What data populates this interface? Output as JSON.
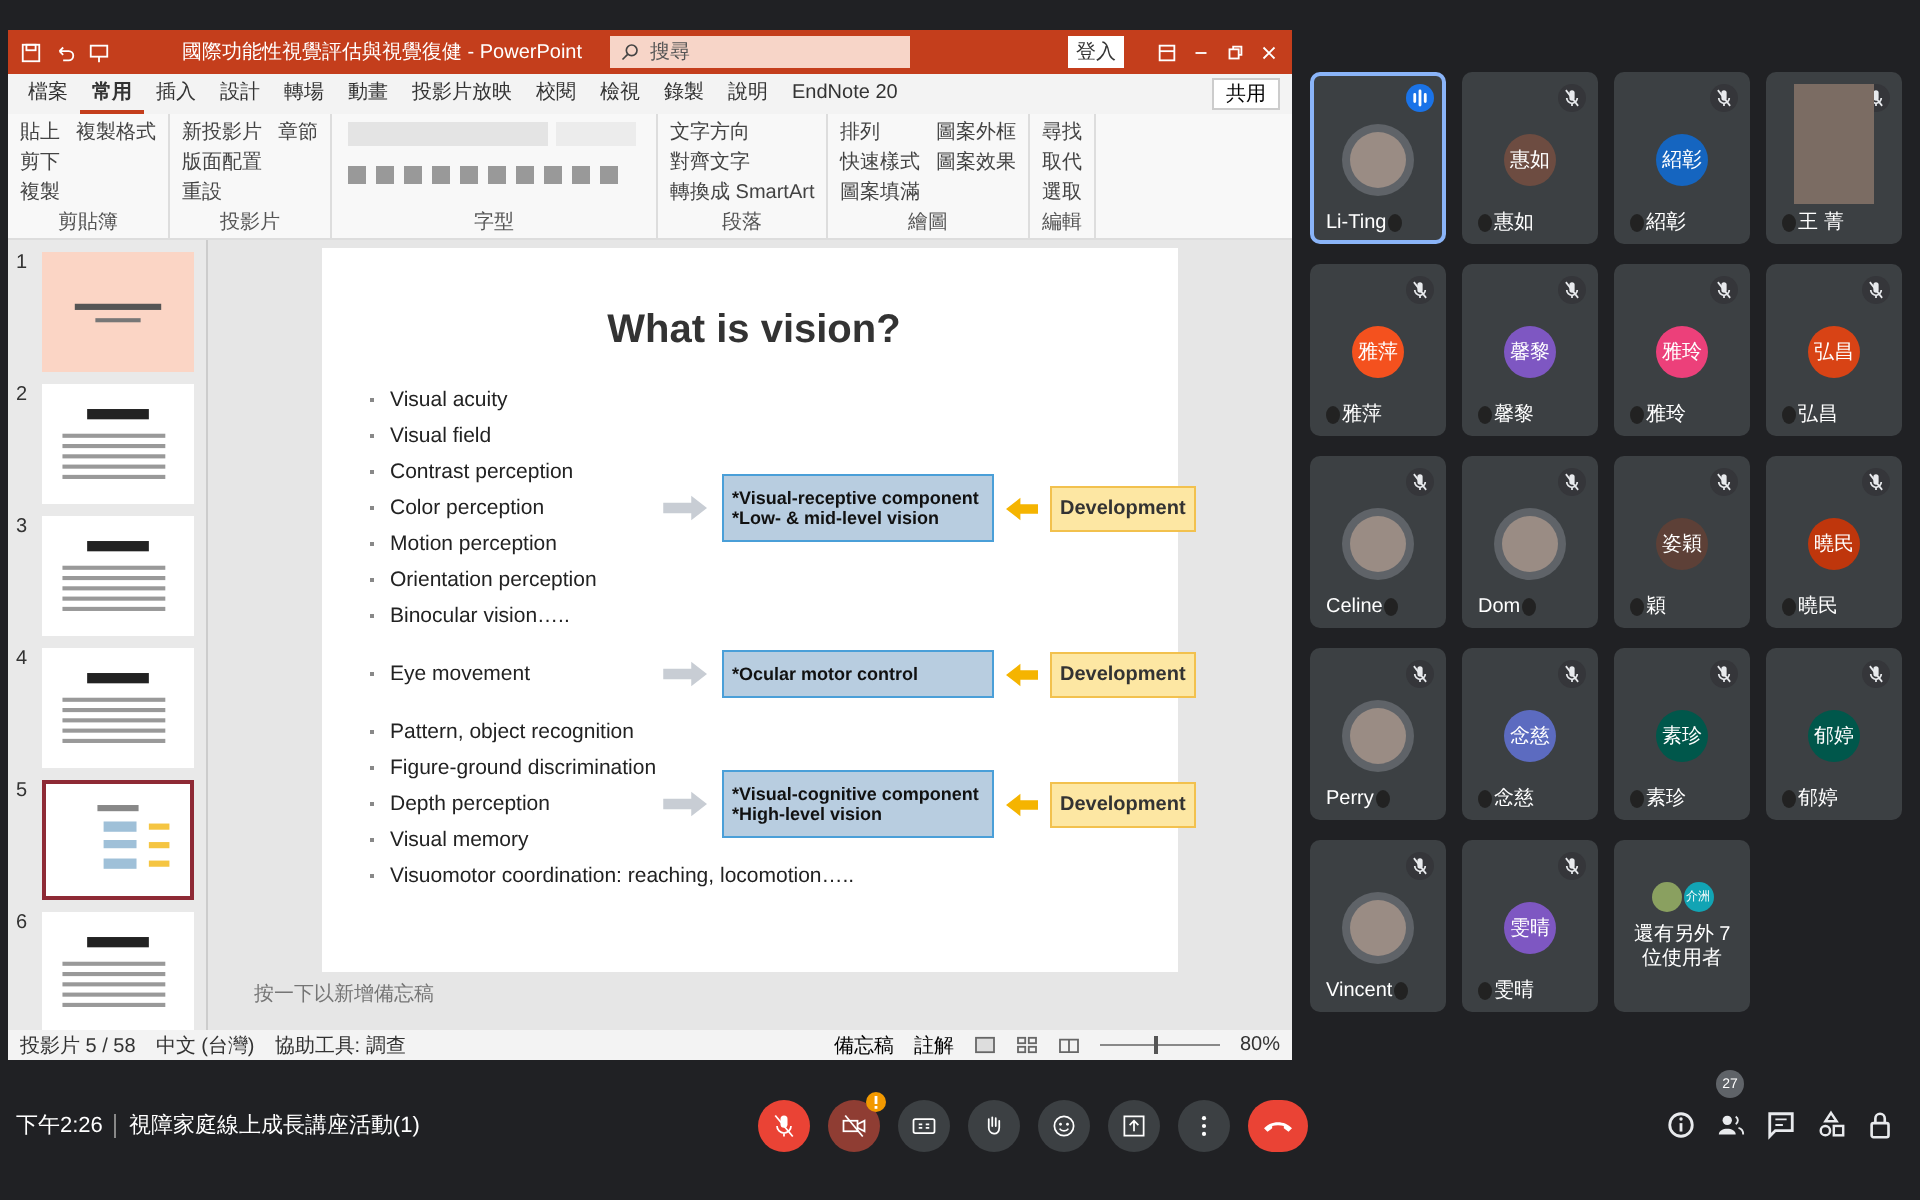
{
  "ppt": {
    "title": "國際功能性視覺評估與視覺復健 - PowerPoint",
    "search": {
      "placeholder": "搜尋"
    },
    "signin": "登入",
    "share": "共用",
    "tabs": [
      {
        "label": "檔案",
        "selected": false
      },
      {
        "label": "常用",
        "selected": true
      },
      {
        "label": "插入",
        "selected": false
      },
      {
        "label": "設計",
        "selected": false
      },
      {
        "label": "轉場",
        "selected": false
      },
      {
        "label": "動畫",
        "selected": false
      },
      {
        "label": "投影片放映",
        "selected": false
      },
      {
        "label": "校閱",
        "selected": false
      },
      {
        "label": "檢視",
        "selected": false
      },
      {
        "label": "錄製",
        "selected": false
      },
      {
        "label": "說明",
        "selected": false
      },
      {
        "label": "EndNote 20",
        "selected": false
      }
    ],
    "ribbon_groups": [
      {
        "name": "剪貼簿",
        "items": [
          "貼上",
          "剪下",
          "複製",
          "複製格式"
        ]
      },
      {
        "name": "投影片",
        "items": [
          "新投影片",
          "版面配置",
          "重設",
          "章節"
        ]
      },
      {
        "name": "字型"
      },
      {
        "name": "段落",
        "items": [
          "文字方向",
          "對齊文字",
          "轉換成 SmartArt"
        ]
      },
      {
        "name": "繪圖",
        "items": [
          "排列",
          "快速樣式",
          "圖案填滿",
          "圖案外框",
          "圖案效果"
        ]
      },
      {
        "name": "編輯",
        "items": [
          "尋找",
          "取代",
          "選取"
        ]
      }
    ]
  },
  "thumbnails": [
    {
      "number": "1",
      "kind": "title",
      "selected": false
    },
    {
      "number": "2",
      "kind": "text",
      "selected": false
    },
    {
      "number": "3",
      "kind": "text",
      "selected": false
    },
    {
      "number": "4",
      "kind": "text",
      "selected": false
    },
    {
      "number": "5",
      "kind": "diagram",
      "selected": true
    },
    {
      "number": "6",
      "kind": "text",
      "selected": false
    }
  ],
  "slide": {
    "title": "What is vision?",
    "groups": [
      {
        "bullets": [
          "Visual acuity",
          "Visual field",
          "Contrast perception",
          "Color perception",
          "Motion perception",
          "Orientation perception",
          "Binocular vision….."
        ],
        "box": [
          "*Visual-receptive component",
          "*Low- & mid-level vision"
        ],
        "tag": "Development"
      },
      {
        "bullets": [
          "Eye movement"
        ],
        "box": [
          "*Ocular motor control"
        ],
        "tag": "Development"
      },
      {
        "bullets": [
          "Pattern, object recognition",
          "Figure-ground discrimination",
          "Depth perception",
          "Visual memory",
          "Visuomotor coordination: reaching, locomotion….."
        ],
        "box": [
          "*Visual-cognitive component",
          "*High-level vision"
        ],
        "tag": "Development"
      }
    ]
  },
  "notes": {
    "placeholder": "按一下以新增備忘稿"
  },
  "status_bar": {
    "slide": "投影片 5 / 58",
    "language": "中文 (台灣)",
    "accessibility": "協助工具: 調查",
    "notes": "備忘稿",
    "comments": "註解",
    "zoom": "80%",
    "zoom_slider": {
      "level": 0.45
    }
  },
  "participants": [
    {
      "name": "Li-Ting",
      "kind": "photo",
      "speaking": true,
      "muted": false
    },
    {
      "name": "惠如",
      "initials": "惠如",
      "kind": "initials",
      "color": "#6d4c41",
      "speaking": false,
      "muted": true
    },
    {
      "name": "紹彰",
      "initials": "紹彰",
      "kind": "initials",
      "color": "#1565c0",
      "speaking": false,
      "muted": true
    },
    {
      "name": "王 菁",
      "kind": "video",
      "speaking": false,
      "muted": true
    },
    {
      "name": "雅萍",
      "initials": "雅萍",
      "kind": "initials",
      "color": "#f4511e",
      "speaking": false,
      "muted": true
    },
    {
      "name": "馨黎",
      "initials": "馨黎",
      "kind": "initials",
      "color": "#7e57c2",
      "speaking": false,
      "muted": true
    },
    {
      "name": "雅玲",
      "initials": "雅玲",
      "kind": "initials",
      "color": "#ec407a",
      "speaking": false,
      "muted": true
    },
    {
      "name": "弘昌",
      "initials": "弘昌",
      "kind": "initials",
      "color": "#d84315",
      "speaking": false,
      "muted": true
    },
    {
      "name": "Celine",
      "kind": "photo",
      "speaking": false,
      "muted": true
    },
    {
      "name": "Dom",
      "kind": "photo",
      "speaking": false,
      "muted": true
    },
    {
      "name": "穎",
      "initials": "姿穎",
      "kind": "initials",
      "color": "#5d4037",
      "speaking": false,
      "muted": true
    },
    {
      "name": "曉民",
      "initials": "曉民",
      "kind": "initials",
      "color": "#bf360c",
      "speaking": false,
      "muted": true
    },
    {
      "name": "Perry",
      "kind": "photo",
      "speaking": false,
      "muted": true
    },
    {
      "name": "念慈",
      "initials": "念慈",
      "kind": "initials",
      "color": "#5c6bc0",
      "speaking": false,
      "muted": true
    },
    {
      "name": "素珍",
      "initials": "素珍",
      "kind": "initials",
      "color": "#00574b",
      "speaking": false,
      "muted": true
    },
    {
      "name": "郁婷",
      "initials": "郁婷",
      "kind": "initials",
      "color": "#00574b",
      "speaking": false,
      "muted": true
    },
    {
      "name": "Vincent",
      "kind": "photo",
      "speaking": false,
      "muted": true
    },
    {
      "name": "雯晴",
      "initials": "雯晴",
      "kind": "initials",
      "color": "#7e57c2",
      "speaking": false,
      "muted": true
    }
  ],
  "others": {
    "label": "還有另外 7 位使用者",
    "initials": "介洲"
  },
  "meeting": {
    "time": "下午2:26",
    "title": "視障家庭線上成長講座活動(1)",
    "people_count": "27",
    "controls": [
      {
        "kind": "mic",
        "off": true
      },
      {
        "kind": "camera",
        "off": true
      },
      {
        "kind": "captions",
        "off": false
      },
      {
        "kind": "hand",
        "off": false
      },
      {
        "kind": "emoji",
        "off": false
      },
      {
        "kind": "present",
        "off": false
      },
      {
        "kind": "more",
        "off": false
      },
      {
        "kind": "end"
      }
    ]
  }
}
